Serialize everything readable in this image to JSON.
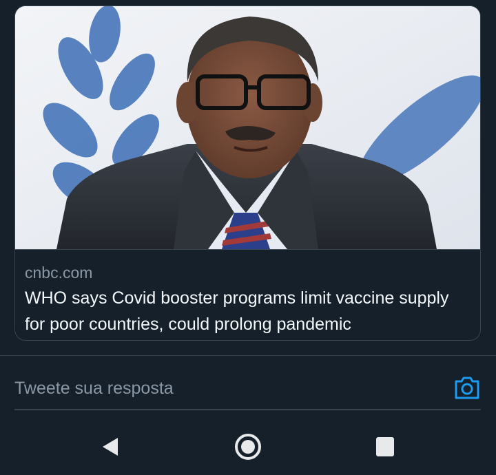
{
  "link_card": {
    "image_icon": "article-photo-portrait",
    "domain": "cnbc.com",
    "title": "WHO says Covid booster programs limit vaccine supply for poor countries, could prolong pandemic"
  },
  "reply": {
    "placeholder": "Tweete sua resposta",
    "camera_icon": "camera-icon"
  },
  "system_nav": {
    "back_icon": "back-triangle-icon",
    "home_icon": "home-circle-icon",
    "recent_icon": "recent-apps-square-icon"
  },
  "colors": {
    "background": "#15202b",
    "border": "#38444d",
    "secondary_text": "#8b98a5",
    "primary_text": "#f5f8fa",
    "accent": "#1d9bf0"
  }
}
